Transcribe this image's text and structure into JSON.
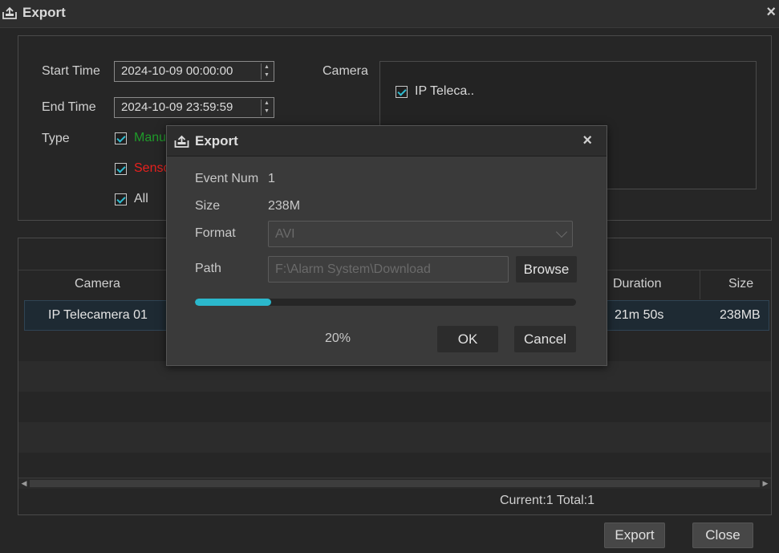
{
  "window": {
    "title": "Export",
    "close_glyph": "×"
  },
  "filter": {
    "start_label": "Start Time",
    "start_value": "2024-10-09 00:00:00",
    "end_label": "End Time",
    "end_value": "2024-10-09 23:59:59",
    "type_label": "Type",
    "types": [
      {
        "label": "Manual",
        "checked": true,
        "color": "#1f9a2a"
      },
      {
        "label": "Sensor",
        "checked": true,
        "color": "#e8211e"
      },
      {
        "label": "All",
        "checked": true,
        "color": "#d0d0d0"
      }
    ],
    "camera_label": "Camera",
    "cameras": [
      {
        "label": "IP Teleca..",
        "checked": true
      }
    ]
  },
  "table": {
    "columns": [
      "Camera",
      "Duration",
      "Size"
    ],
    "rows": [
      {
        "camera": "IP Telecamera 01",
        "duration": "21m 50s",
        "size": "238MB"
      }
    ],
    "status": "Current:1 Total:1"
  },
  "buttons": {
    "export": "Export",
    "close": "Close"
  },
  "dialog": {
    "title": "Export",
    "close_glyph": "×",
    "event_num_label": "Event Num",
    "event_num_value": "1",
    "size_label": "Size",
    "size_value": "238M",
    "format_label": "Format",
    "format_value": "AVI",
    "path_label": "Path",
    "path_value": "F:\\Alarm System\\Download",
    "browse": "Browse",
    "progress_percent": 20,
    "progress_text": "20%",
    "ok": "OK",
    "cancel": "Cancel"
  },
  "colors": {
    "accent": "#2bb8cc",
    "background": "#262626"
  }
}
